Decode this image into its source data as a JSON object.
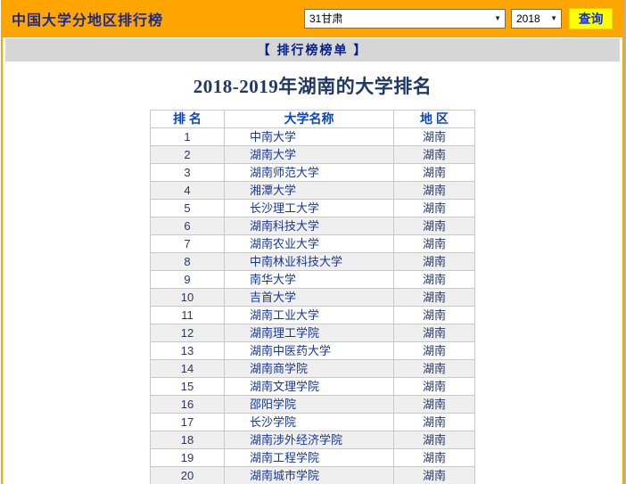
{
  "colors": {
    "header_bg": "#FFA500",
    "button_bg": "#FFFF00",
    "strip_bg": "#D6D6D6",
    "header_title_text": "#1A2A8C",
    "page_title_text": "#203864",
    "table_header_text": "#0B46C4",
    "link_text": "#1537A0",
    "dark_navy_text": "#26386B",
    "table_border": "#C8C8C8"
  },
  "header": {
    "title": "中国大学分地区排行榜",
    "region_select": {
      "value": "31甘肃"
    },
    "year_select": {
      "value": "2018"
    },
    "query_button_label": "查询"
  },
  "nav": {
    "ranking_link_label": "【 排行榜榜单 】"
  },
  "main": {
    "page_title": "2018-2019年湖南的大学排名"
  },
  "table": {
    "headers": [
      "排 名",
      "大学名称",
      "地 区"
    ],
    "rows": [
      {
        "rank": "1",
        "university": "中南大学",
        "region": "湖南"
      },
      {
        "rank": "2",
        "university": "湖南大学",
        "region": "湖南"
      },
      {
        "rank": "3",
        "university": "湖南师范大学",
        "region": "湖南"
      },
      {
        "rank": "4",
        "university": "湘潭大学",
        "region": "湖南"
      },
      {
        "rank": "5",
        "university": "长沙理工大学",
        "region": "湖南"
      },
      {
        "rank": "6",
        "university": "湖南科技大学",
        "region": "湖南"
      },
      {
        "rank": "7",
        "university": "湖南农业大学",
        "region": "湖南"
      },
      {
        "rank": "8",
        "university": "中南林业科技大学",
        "region": "湖南"
      },
      {
        "rank": "9",
        "university": "南华大学",
        "region": "湖南"
      },
      {
        "rank": "10",
        "university": "吉首大学",
        "region": "湖南"
      },
      {
        "rank": "11",
        "university": "湖南工业大学",
        "region": "湖南"
      },
      {
        "rank": "12",
        "university": "湖南理工学院",
        "region": "湖南"
      },
      {
        "rank": "13",
        "university": "湖南中医药大学",
        "region": "湖南"
      },
      {
        "rank": "14",
        "university": "湖南商学院",
        "region": "湖南"
      },
      {
        "rank": "15",
        "university": "湖南文理学院",
        "region": "湖南"
      },
      {
        "rank": "16",
        "university": "邵阳学院",
        "region": "湖南"
      },
      {
        "rank": "17",
        "university": "长沙学院",
        "region": "湖南"
      },
      {
        "rank": "18",
        "university": "湖南涉外经济学院",
        "region": "湖南"
      },
      {
        "rank": "19",
        "university": "湖南工程学院",
        "region": "湖南"
      },
      {
        "rank": "20",
        "university": "湖南城市学院",
        "region": "湖南"
      }
    ]
  }
}
